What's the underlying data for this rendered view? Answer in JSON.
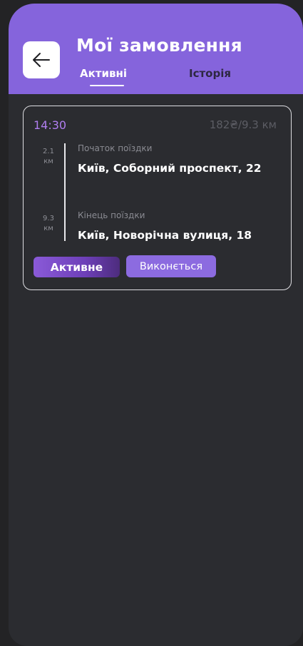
{
  "header": {
    "title": "Мої замовлення",
    "back_icon": "arrow-left-icon",
    "tabs": [
      {
        "label": "Активні",
        "selected": true
      },
      {
        "label": "Історія",
        "selected": false
      }
    ]
  },
  "order": {
    "time": "14:30",
    "price_distance": "182₴/9.3 км",
    "start": {
      "distance_value": "2.1",
      "distance_unit": "км",
      "label": "Початок поїздки",
      "address": "Київ, Соборний проспект, 22"
    },
    "end": {
      "distance_value": "9.3",
      "distance_unit": "км",
      "label": "Кінець поїздки",
      "address": "Київ, Новорічна вулиця, 18"
    },
    "status_badge": "Активне",
    "progress_badge": "Виконється"
  },
  "colors": {
    "accent": "#8564dc",
    "time": "#b07ef0",
    "background": "#2b2c30"
  }
}
